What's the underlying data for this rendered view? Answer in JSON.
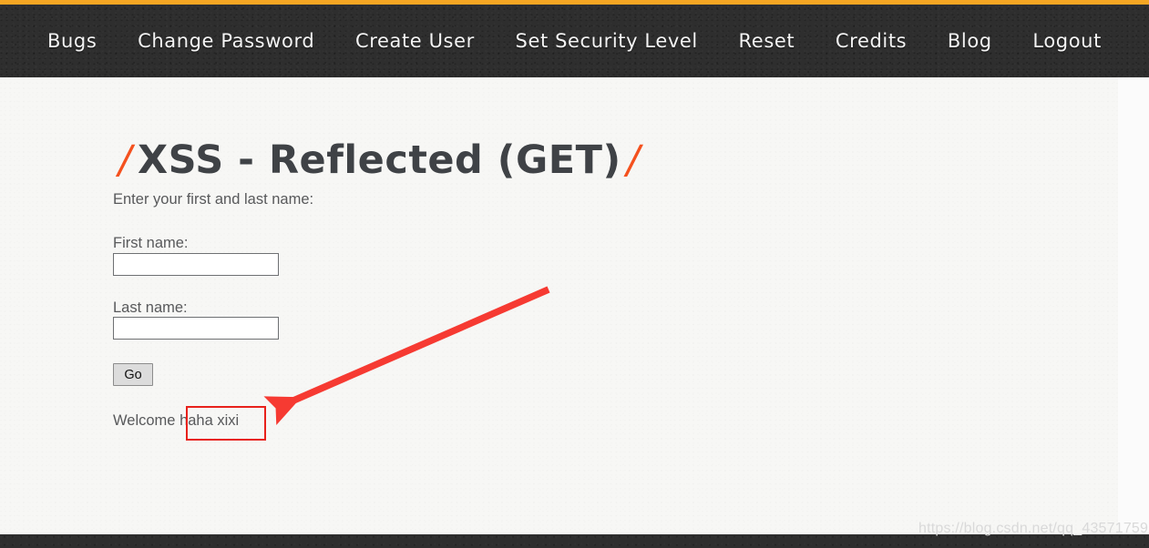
{
  "theme": {
    "accent_orange": "#F5A623",
    "title_slash": "#F4511E",
    "navbar_bg": "#2e2e2e",
    "page_bg": "#f7f7f5",
    "annotation_red": "#E8211B",
    "text_gray": "#58595b"
  },
  "navbar": {
    "items": [
      {
        "label": "Bugs"
      },
      {
        "label": "Change Password"
      },
      {
        "label": "Create User"
      },
      {
        "label": "Set Security Level"
      },
      {
        "label": "Reset"
      },
      {
        "label": "Credits"
      },
      {
        "label": "Blog"
      },
      {
        "label": "Logout"
      }
    ]
  },
  "main": {
    "title": {
      "left_slash": "/",
      "text": "XSS - Reflected (GET)",
      "right_slash": "/"
    },
    "intro": "Enter your first and last name:",
    "form": {
      "first_name": {
        "label": "First name:",
        "value": "",
        "placeholder": ""
      },
      "last_name": {
        "label": "Last name:",
        "value": "",
        "placeholder": ""
      },
      "submit_label": "Go"
    },
    "result": {
      "prefix": "Welcome ",
      "reflected_value": "haha xixi"
    }
  },
  "watermark": {
    "text": "https://blog.csdn.net/qq_43571759"
  }
}
